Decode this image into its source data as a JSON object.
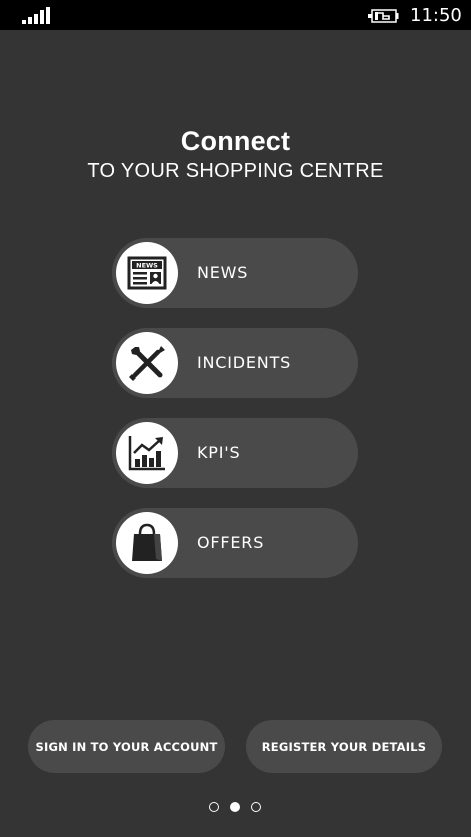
{
  "status": {
    "time": "11:50",
    "signal_icon": "signal-icon",
    "battery_icon": "battery-charging-icon"
  },
  "header": {
    "title": "Connect",
    "subtitle": "TO YOUR SHOPPING CENTRE"
  },
  "menu": {
    "items": [
      {
        "label": "NEWS",
        "icon": "newspaper-icon"
      },
      {
        "label": "INCIDENTS",
        "icon": "tools-icon"
      },
      {
        "label": "KPI'S",
        "icon": "chart-icon"
      },
      {
        "label": "OFFERS",
        "icon": "shopping-bag-icon"
      }
    ]
  },
  "footer": {
    "sign_in_label": "SIGN IN TO YOUR ACCOUNT",
    "register_label": "REGISTER YOUR DETAILS"
  },
  "pager": {
    "active_index": 1,
    "count": 3
  },
  "colors": {
    "background": "#343434",
    "pill": "#4a4a4a",
    "status_bar": "#000000",
    "text": "#ffffff"
  }
}
